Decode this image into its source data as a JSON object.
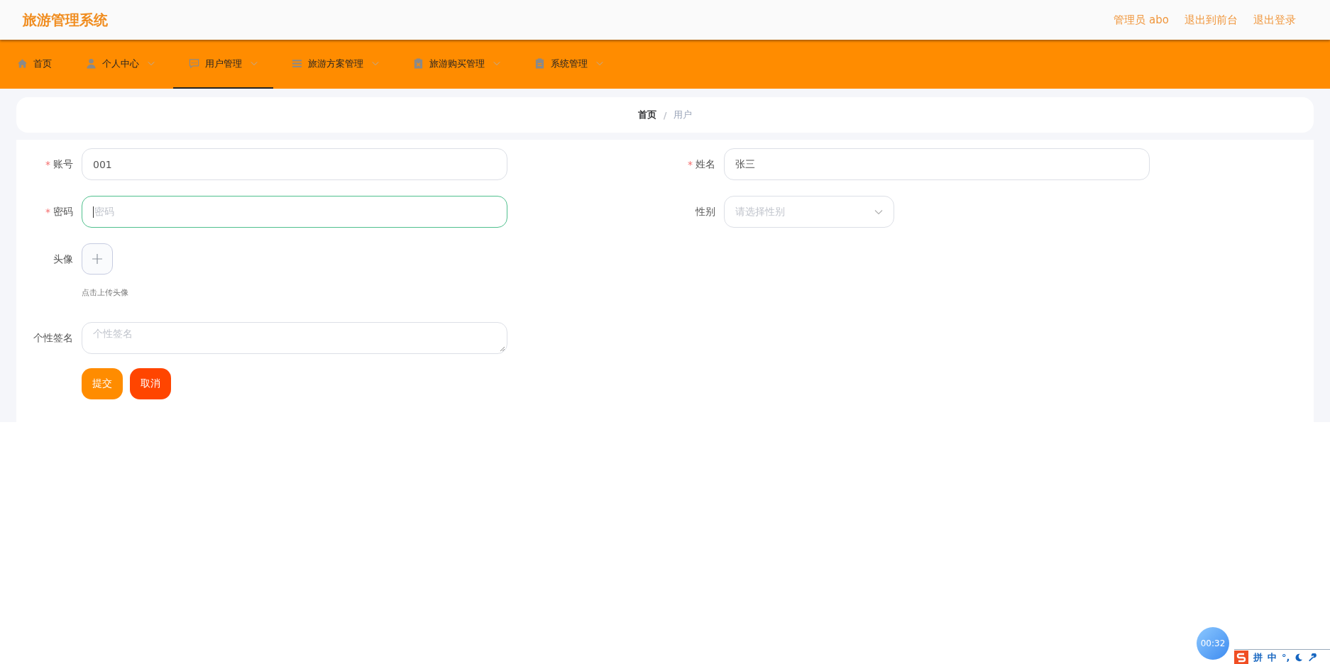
{
  "header": {
    "title": "旅游管理系统",
    "links": [
      "管理员 abo",
      "退出到前台",
      "退出登录"
    ]
  },
  "nav": [
    {
      "label": "首页",
      "dropdown": false,
      "selected": false
    },
    {
      "label": "个人中心",
      "dropdown": true,
      "selected": false
    },
    {
      "label": "用户管理",
      "dropdown": true,
      "selected": true
    },
    {
      "label": "旅游方案管理",
      "dropdown": true,
      "selected": false
    },
    {
      "label": "旅游购买管理",
      "dropdown": true,
      "selected": false
    },
    {
      "label": "系统管理",
      "dropdown": true,
      "selected": false
    }
  ],
  "breadcrumb": {
    "items": [
      "首页",
      "用户"
    ],
    "separator": "/"
  },
  "form": {
    "required_mark": "*",
    "rows": [
      {
        "fields": [
          {
            "kind": "input",
            "label": "账号",
            "required": true,
            "value": "001",
            "focused": false
          },
          {
            "kind": "input",
            "label": "姓名",
            "required": true,
            "value": "张三",
            "focused": false
          }
        ]
      },
      {
        "fields": [
          {
            "kind": "input",
            "label": "密码",
            "required": true,
            "placeholder": "密码",
            "focused": true
          },
          {
            "kind": "select",
            "label": "性别",
            "required": false,
            "placeholder": "请选择性别"
          }
        ]
      },
      {
        "fields": [
          {
            "kind": "upload",
            "label": "头像",
            "required": false,
            "hint": "点击上传头像"
          }
        ]
      },
      {
        "fields": [
          {
            "kind": "textarea",
            "label": "个性签名",
            "required": false,
            "placeholder": "个性签名"
          }
        ]
      }
    ],
    "buttons": [
      {
        "label": "提交",
        "kind": "primary"
      },
      {
        "label": "取消",
        "kind": "danger"
      }
    ]
  },
  "overlay": {
    "timer": "00:32",
    "ime": [
      "拼",
      "中",
      "°,"
    ]
  }
}
